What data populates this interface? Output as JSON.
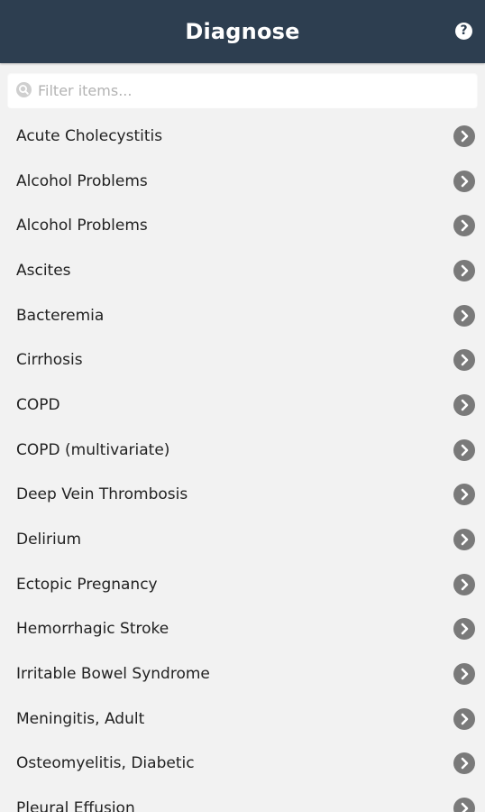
{
  "header": {
    "title": "Diagnose",
    "help_label": "?"
  },
  "search": {
    "placeholder": "Filter items...",
    "value": ""
  },
  "icons": {
    "search": "search-icon",
    "row_action": "chevron-right-icon",
    "help": "question-icon"
  },
  "colors": {
    "header_bg": "#2d3e50",
    "page_bg": "#f2f2f2",
    "chevron": "#7a7a7a"
  },
  "items": [
    {
      "label": "Acute Cholecystitis"
    },
    {
      "label": "Alcohol Problems"
    },
    {
      "label": "Alcohol Problems"
    },
    {
      "label": "Ascites"
    },
    {
      "label": "Bacteremia"
    },
    {
      "label": "Cirrhosis"
    },
    {
      "label": "COPD"
    },
    {
      "label": "COPD (multivariate)"
    },
    {
      "label": "Deep Vein Thrombosis"
    },
    {
      "label": "Delirium"
    },
    {
      "label": "Ectopic Pregnancy"
    },
    {
      "label": "Hemorrhagic Stroke"
    },
    {
      "label": "Irritable Bowel Syndrome"
    },
    {
      "label": "Meningitis, Adult"
    },
    {
      "label": "Osteomyelitis, Diabetic"
    },
    {
      "label": "Pleural Effusion"
    }
  ]
}
